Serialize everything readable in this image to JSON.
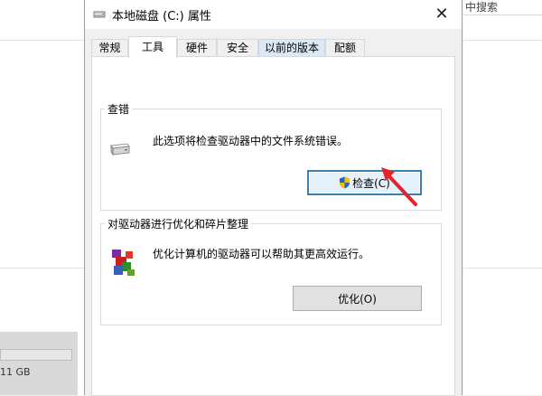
{
  "background": {
    "search_text": "中搜索",
    "drive_size": "11 GB"
  },
  "dialog": {
    "title": "本地磁盘 (C:) 属性",
    "close_glyph": "✕"
  },
  "tabs": [
    {
      "label": "常规"
    },
    {
      "label": "工具"
    },
    {
      "label": "硬件"
    },
    {
      "label": "安全"
    },
    {
      "label": "以前的版本"
    },
    {
      "label": "配额"
    }
  ],
  "error_check": {
    "title": "查错",
    "description": "此选项将检查驱动器中的文件系统错误。",
    "button_label": "检查(C)"
  },
  "optimize": {
    "title": "对驱动器进行优化和碎片整理",
    "description": "优化计算机的驱动器可以帮助其更高效运行。",
    "button_label": "优化(O)"
  },
  "colors": {
    "accent": "#3c7fb1",
    "annotation_arrow": "#e8222a"
  }
}
